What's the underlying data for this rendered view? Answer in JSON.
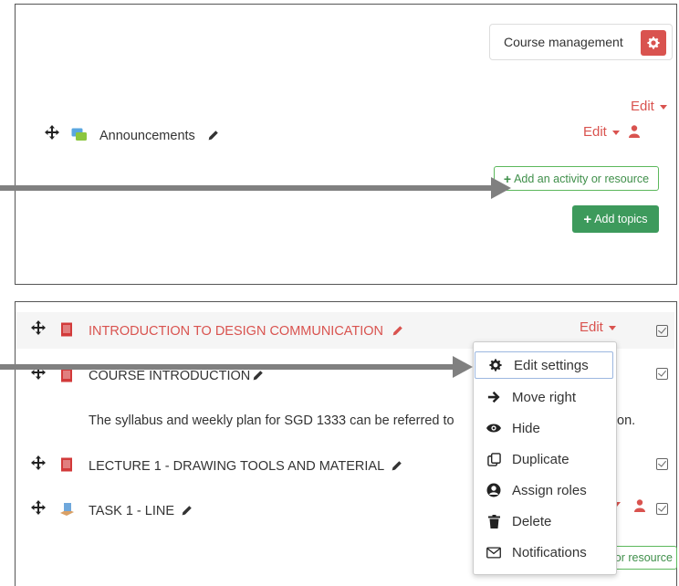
{
  "course_management": {
    "label": "Course management",
    "icon": "gear-icon"
  },
  "section": {
    "edit_label": "Edit"
  },
  "announcements": {
    "label": "Announcements",
    "edit_label": "Edit"
  },
  "add_activity": {
    "label": "Add an activity or resource"
  },
  "add_topics": {
    "label": "Add topics"
  },
  "activities": [
    {
      "label": "INTRODUCTION TO DESIGN COMMUNICATION",
      "edit_label": "Edit",
      "highlighted": true
    },
    {
      "label": "COURSE INTRODUCTION"
    },
    {
      "label": "LECTURE 1 - DRAWING TOOLS AND MATERIAL"
    },
    {
      "label": "TASK 1 - LINE"
    }
  ],
  "description": {
    "text_before": "The syllabus and weekly plan for SGD 1333 can be referred to",
    "text_after": "on."
  },
  "bottom_add_partial": "or resource",
  "context_menu": [
    {
      "label": "Edit settings",
      "icon": "gear-icon"
    },
    {
      "label": "Move right",
      "icon": "arrow-right-icon"
    },
    {
      "label": "Hide",
      "icon": "eye-icon"
    },
    {
      "label": "Duplicate",
      "icon": "duplicate-icon"
    },
    {
      "label": "Assign roles",
      "icon": "user-circle-icon"
    },
    {
      "label": "Delete",
      "icon": "trash-icon"
    },
    {
      "label": "Notifications",
      "icon": "envelope-icon"
    }
  ],
  "colors": {
    "accent_red": "#d9534f",
    "green": "#3d9a5c",
    "annotation_arrow": "#808080"
  }
}
